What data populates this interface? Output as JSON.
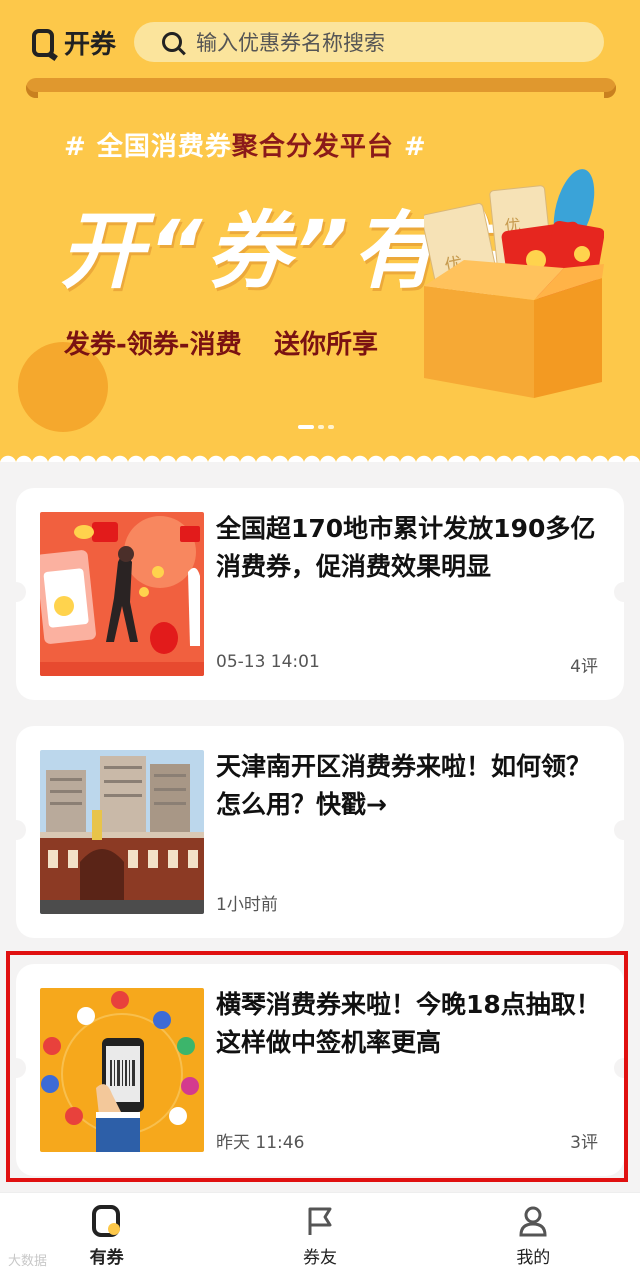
{
  "app": {
    "logo_text": "开券",
    "search_placeholder": "输入优惠券名称搜索"
  },
  "banner": {
    "subtitle_prefix": "# 全国消费券",
    "subtitle_accent": "聚合分发平台",
    "subtitle_suffix": " #",
    "title": "开“券”有益",
    "slogan_left": "发券-领券-消费",
    "slogan_right": "送你所享",
    "ticket_text": "优惠券",
    "ticket_text_2": "优惠",
    "page_count": 3,
    "active_page": 1
  },
  "articles": [
    {
      "title": "全国超170地市累计发放190多亿消费券，促消费效果明显",
      "time": "05-13 14:01",
      "comments": "4评"
    },
    {
      "title": "天津南开区消费券来啦！如何领？怎么用？快戳→",
      "time": "1小时前",
      "comments": ""
    },
    {
      "title": "横琴消费券来啦！今晚18点抽取！这样做中签机率更高",
      "time": "昨天 11:46",
      "comments": "3评"
    }
  ],
  "nav": {
    "items": [
      {
        "label": "有券",
        "icon": "coupon-home-icon",
        "active": true
      },
      {
        "label": "券友",
        "icon": "flag-icon",
        "active": false
      },
      {
        "label": "我的",
        "icon": "user-icon",
        "active": false
      }
    ]
  },
  "watermark": "大数据",
  "colors": {
    "brand_yellow": "#fdc84a",
    "highlight_red": "#e01010"
  }
}
